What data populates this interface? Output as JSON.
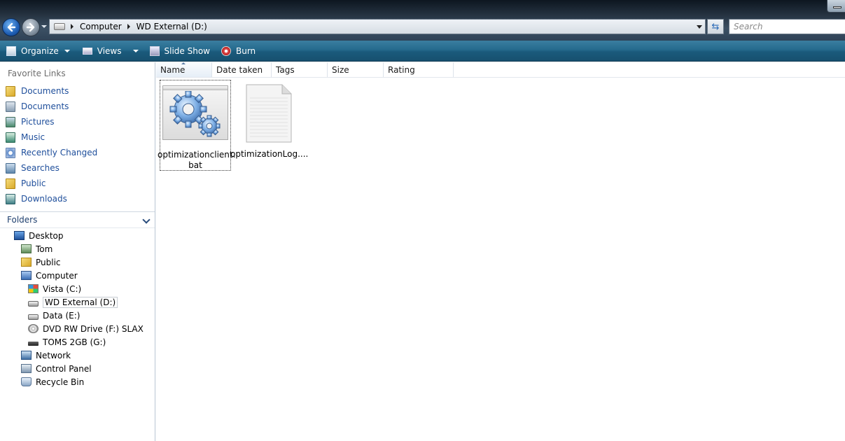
{
  "address_bar": {
    "breadcrumbs": [
      "Computer",
      "WD External (D:)"
    ],
    "search_placeholder": "Search"
  },
  "command_bar": {
    "organize": "Organize",
    "views": "Views",
    "slide_show": "Slide Show",
    "burn": "Burn"
  },
  "nav_pane": {
    "favorite_links_header": "Favorite Links",
    "favorites": [
      {
        "label": "Documents",
        "icon": "folder-icon"
      },
      {
        "label": "Documents",
        "icon": "documents-icon"
      },
      {
        "label": "Pictures",
        "icon": "pictures-icon"
      },
      {
        "label": "Music",
        "icon": "music-icon"
      },
      {
        "label": "Recently Changed",
        "icon": "recently-changed-icon"
      },
      {
        "label": "Searches",
        "icon": "searches-icon"
      },
      {
        "label": "Public",
        "icon": "folder-icon"
      },
      {
        "label": "Downloads",
        "icon": "downloads-icon"
      }
    ],
    "folders_header": "Folders",
    "tree": [
      {
        "label": "Desktop",
        "icon": "desktop-icon",
        "level": 0
      },
      {
        "label": "Tom",
        "icon": "user-folder-icon",
        "level": 1
      },
      {
        "label": "Public",
        "icon": "folder-icon",
        "level": 1
      },
      {
        "label": "Computer",
        "icon": "computer-icon",
        "level": 1
      },
      {
        "label": "Vista (C:)",
        "icon": "system-drive-icon",
        "level": 2
      },
      {
        "label": "WD External (D:)",
        "icon": "drive-icon",
        "level": 2,
        "selected": true
      },
      {
        "label": "Data (E:)",
        "icon": "drive-icon",
        "level": 2
      },
      {
        "label": "DVD RW Drive (F:) SLAX",
        "icon": "dvd-drive-icon",
        "level": 2
      },
      {
        "label": "TOMS 2GB (G:)",
        "icon": "usb-drive-icon",
        "level": 2
      },
      {
        "label": "Network",
        "icon": "network-icon",
        "level": 1
      },
      {
        "label": "Control Panel",
        "icon": "control-panel-icon",
        "level": 1
      },
      {
        "label": "Recycle Bin",
        "icon": "recycle-bin-icon",
        "level": 1
      }
    ]
  },
  "content": {
    "columns": [
      "Name",
      "Date taken",
      "Tags",
      "Size",
      "Rating"
    ],
    "files": [
      {
        "name_line1": "optimizationclient.",
        "name_line2": "bat",
        "icon": "batch-file-gear-icon"
      },
      {
        "name_line1": "optimizationLog....",
        "name_line2": "",
        "icon": "text-document-icon"
      }
    ]
  }
}
